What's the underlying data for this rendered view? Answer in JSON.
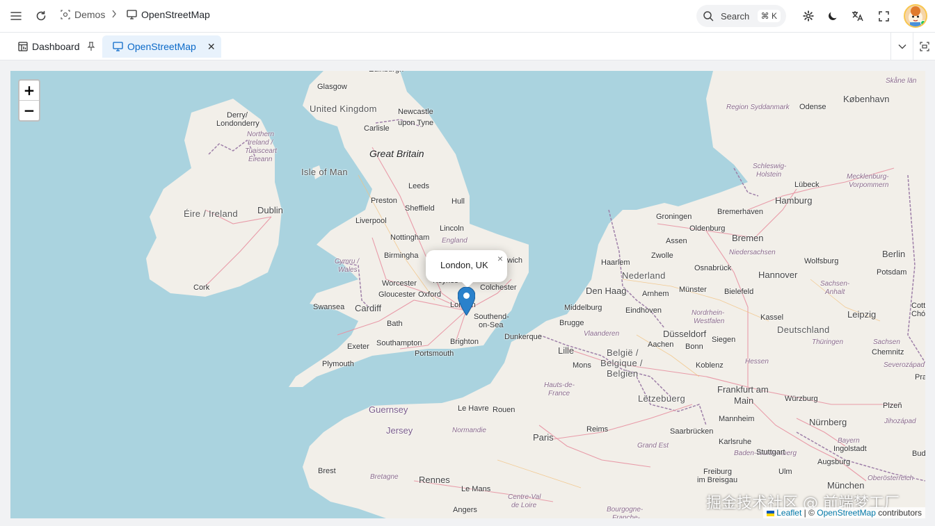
{
  "header": {
    "breadcrumb": {
      "parent": "Demos",
      "current": "OpenStreetMap"
    },
    "search": {
      "placeholder": "Search",
      "shortcut": "⌘ K"
    },
    "icons": [
      "menu-icon",
      "reload-icon",
      "settings-icon",
      "moon-icon",
      "translate-icon",
      "fullscreen-icon"
    ]
  },
  "tabs": [
    {
      "label": "Dashboard",
      "pinned": true,
      "active": false
    },
    {
      "label": "OpenStreetMap",
      "pinned": false,
      "active": true
    }
  ],
  "map": {
    "zoom_in": "+",
    "zoom_out": "−",
    "popup": {
      "text": "London, UK",
      "close": "×"
    },
    "attribution": {
      "leaflet": "Leaflet",
      "sep": " | © ",
      "osm": "OpenStreetMap",
      "suffix": " contributors"
    },
    "watermark": "掘金技术社区 @ 前端梦工厂",
    "labels": [
      {
        "id": "edinburgh",
        "text": "Edinburgh"
      },
      {
        "id": "glasgow",
        "text": "Glasgow"
      },
      {
        "id": "united-kingdom",
        "text": "United Kingdom"
      },
      {
        "id": "newcastle-1",
        "text": "Newcastle"
      },
      {
        "id": "newcastle-2",
        "text": "upon Tyne"
      },
      {
        "id": "carlisle",
        "text": "Carlisle"
      },
      {
        "id": "derry-1",
        "text": "Derry/"
      },
      {
        "id": "derry-2",
        "text": "Londonderry"
      },
      {
        "id": "ni-1",
        "text": "Northern"
      },
      {
        "id": "ni-2",
        "text": "Ireland /"
      },
      {
        "id": "ni-3",
        "text": "Tuaisceart"
      },
      {
        "id": "ni-4",
        "text": "Éireann"
      },
      {
        "id": "great-britain",
        "text": "Great Britain"
      },
      {
        "id": "isle-of-man",
        "text": "Isle of Man"
      },
      {
        "id": "leeds",
        "text": "Leeds"
      },
      {
        "id": "preston",
        "text": "Preston"
      },
      {
        "id": "hull",
        "text": "Hull"
      },
      {
        "id": "sheffield",
        "text": "Sheffield"
      },
      {
        "id": "dublin",
        "text": "Dublin"
      },
      {
        "id": "eire",
        "text": "Éire / Ireland"
      },
      {
        "id": "liverpool",
        "text": "Liverpool"
      },
      {
        "id": "lincoln",
        "text": "Lincoln"
      },
      {
        "id": "nottingham",
        "text": "Nottingham"
      },
      {
        "id": "england",
        "text": "England"
      },
      {
        "id": "cymru-1",
        "text": "Cymru /"
      },
      {
        "id": "cymru-2",
        "text": "Wales"
      },
      {
        "id": "birmingham",
        "text": "Birmingha"
      },
      {
        "id": "ipswich",
        "text": "wich"
      },
      {
        "id": "keynes",
        "text": "Keynes"
      },
      {
        "id": "colchester",
        "text": "Colchester"
      },
      {
        "id": "cork",
        "text": "Cork"
      },
      {
        "id": "worcester",
        "text": "Worcester"
      },
      {
        "id": "gloucester",
        "text": "Gloucester"
      },
      {
        "id": "oxford",
        "text": "Oxford"
      },
      {
        "id": "london",
        "text": "London"
      },
      {
        "id": "swansea",
        "text": "Swansea"
      },
      {
        "id": "cardiff",
        "text": "Cardiff"
      },
      {
        "id": "southend-1",
        "text": "Southend-"
      },
      {
        "id": "southend-2",
        "text": "on-Sea"
      },
      {
        "id": "bath",
        "text": "Bath"
      },
      {
        "id": "dunkerque",
        "text": "Dunkerque"
      },
      {
        "id": "brighton",
        "text": "Brighton"
      },
      {
        "id": "exeter",
        "text": "Exeter"
      },
      {
        "id": "southampton",
        "text": "Southampton"
      },
      {
        "id": "portsmouth",
        "text": "Portsmouth"
      },
      {
        "id": "plymouth",
        "text": "Plymouth"
      },
      {
        "id": "guernsey",
        "text": "Guernsey"
      },
      {
        "id": "jersey",
        "text": "Jersey"
      },
      {
        "id": "le-havre",
        "text": "Le Havre"
      },
      {
        "id": "rouen",
        "text": "Rouen"
      },
      {
        "id": "normandie",
        "text": "Normandie"
      },
      {
        "id": "paris",
        "text": "Paris"
      },
      {
        "id": "brest",
        "text": "Brest"
      },
      {
        "id": "bretagne",
        "text": "Bretagne"
      },
      {
        "id": "rennes",
        "text": "Rennes"
      },
      {
        "id": "le-mans",
        "text": "Le Mans"
      },
      {
        "id": "angers",
        "text": "Angers"
      },
      {
        "id": "cvdl-1",
        "text": "Centre-Val"
      },
      {
        "id": "cvdl-2",
        "text": "de Loire"
      },
      {
        "id": "hdf-1",
        "text": "Hauts-de-"
      },
      {
        "id": "hdf-2",
        "text": "France"
      },
      {
        "id": "lille",
        "text": "Lille"
      },
      {
        "id": "mons",
        "text": "Mons"
      },
      {
        "id": "brugge",
        "text": "Brugge"
      },
      {
        "id": "vlaanderen",
        "text": "Vlaanderen"
      },
      {
        "id": "belgie-1",
        "text": "België /"
      },
      {
        "id": "belgie-2",
        "text": "Belgique /"
      },
      {
        "id": "belgie-3",
        "text": "Belgien"
      },
      {
        "id": "reims",
        "text": "Reims"
      },
      {
        "id": "grand-est",
        "text": "Grand Est"
      },
      {
        "id": "bourgogne-1",
        "text": "Bourgogne-"
      },
      {
        "id": "bourgogne-2",
        "text": "Franche-"
      },
      {
        "id": "letzebuerg",
        "text": "Lëtzebuerg"
      },
      {
        "id": "middelburg",
        "text": "Middelburg"
      },
      {
        "id": "den-haag",
        "text": "Den Haag"
      },
      {
        "id": "haarlem",
        "text": "Haarlem"
      },
      {
        "id": "nederland",
        "text": "Nederland"
      },
      {
        "id": "zwolle",
        "text": "Zwolle"
      },
      {
        "id": "arnhem",
        "text": "Arnhem"
      },
      {
        "id": "eindhoven",
        "text": "Eindhoven"
      },
      {
        "id": "groningen",
        "text": "Groningen"
      },
      {
        "id": "assen",
        "text": "Assen"
      },
      {
        "id": "oldenburg",
        "text": "Oldenburg"
      },
      {
        "id": "bremerhaven",
        "text": "Bremerhaven"
      },
      {
        "id": "bremen",
        "text": "Bremen"
      },
      {
        "id": "niedersachsen",
        "text": "Niedersachsen"
      },
      {
        "id": "osnabruck",
        "text": "Osnabrück"
      },
      {
        "id": "munster",
        "text": "Münster"
      },
      {
        "id": "bielefeld",
        "text": "Bielefeld"
      },
      {
        "id": "hannover",
        "text": "Hannover"
      },
      {
        "id": "wolfsburg",
        "text": "Wolfsburg"
      },
      {
        "id": "berlin",
        "text": "Berlin"
      },
      {
        "id": "potsdam",
        "text": "Potsdam"
      },
      {
        "id": "hamburg",
        "text": "Hamburg"
      },
      {
        "id": "lubeck",
        "text": "Lübeck"
      },
      {
        "id": "sh-1",
        "text": "Schleswig-"
      },
      {
        "id": "sh-2",
        "text": "Holstein"
      },
      {
        "id": "mv-1",
        "text": "Mecklenburg-"
      },
      {
        "id": "mv-2",
        "text": "Vorpommern"
      },
      {
        "id": "region-syddanmark",
        "text": "Region Syddanmark"
      },
      {
        "id": "odense",
        "text": "Odense"
      },
      {
        "id": "kobenhavn",
        "text": "København"
      },
      {
        "id": "skane",
        "text": "Skåne län"
      },
      {
        "id": "nrw-1",
        "text": "Nordrhein-"
      },
      {
        "id": "nrw-2",
        "text": "Westfalen"
      },
      {
        "id": "dusseldorf",
        "text": "Düsseldorf"
      },
      {
        "id": "aachen",
        "text": "Aachen"
      },
      {
        "id": "bonn",
        "text": "Bonn"
      },
      {
        "id": "siegen",
        "text": "Siegen"
      },
      {
        "id": "kassel",
        "text": "Kassel"
      },
      {
        "id": "deutschland",
        "text": "Deutschland"
      },
      {
        "id": "leipzig",
        "text": "Leipzig"
      },
      {
        "id": "sa-1",
        "text": "Sachsen-"
      },
      {
        "id": "sa-2",
        "text": "Anhalt"
      },
      {
        "id": "thuringen",
        "text": "Thüringen"
      },
      {
        "id": "sachsen",
        "text": "Sachsen"
      },
      {
        "id": "cottbus-1",
        "text": "Cotti"
      },
      {
        "id": "cottbus-2",
        "text": "Chós"
      },
      {
        "id": "chemnitz",
        "text": "Chemnitz"
      },
      {
        "id": "koblenz",
        "text": "Koblenz"
      },
      {
        "id": "hessen",
        "text": "Hessen"
      },
      {
        "id": "frankfurt-1",
        "text": "Frankfurt am"
      },
      {
        "id": "frankfurt-2",
        "text": "Main"
      },
      {
        "id": "wurzburg",
        "text": "Würzburg"
      },
      {
        "id": "severozapad",
        "text": "Severozápad"
      },
      {
        "id": "praha",
        "text": "Pra"
      },
      {
        "id": "plzen",
        "text": "Plzeň"
      },
      {
        "id": "jihozapad",
        "text": "Jihozápad"
      },
      {
        "id": "mannheim",
        "text": "Mannheim"
      },
      {
        "id": "nurnberg",
        "text": "Nürnberg"
      },
      {
        "id": "saarbrucken",
        "text": "Saarbrücken"
      },
      {
        "id": "karlsruhe",
        "text": "Karlsruhe"
      },
      {
        "id": "ingolstadt",
        "text": "Ingolstadt"
      },
      {
        "id": "bayern",
        "text": "Bayern"
      },
      {
        "id": "bw",
        "text": "Baden-Württemberg"
      },
      {
        "id": "stuttgart",
        "text": "Stuttgart"
      },
      {
        "id": "ulm",
        "text": "Ulm"
      },
      {
        "id": "augsburg",
        "text": "Augsburg"
      },
      {
        "id": "budejovice",
        "text": "Budě"
      },
      {
        "id": "freiburg-1",
        "text": "Freiburg"
      },
      {
        "id": "freiburg-2",
        "text": "im Breisgau"
      },
      {
        "id": "munchen",
        "text": "München"
      },
      {
        "id": "oberosterreich",
        "text": "Oberösterreich"
      }
    ]
  }
}
